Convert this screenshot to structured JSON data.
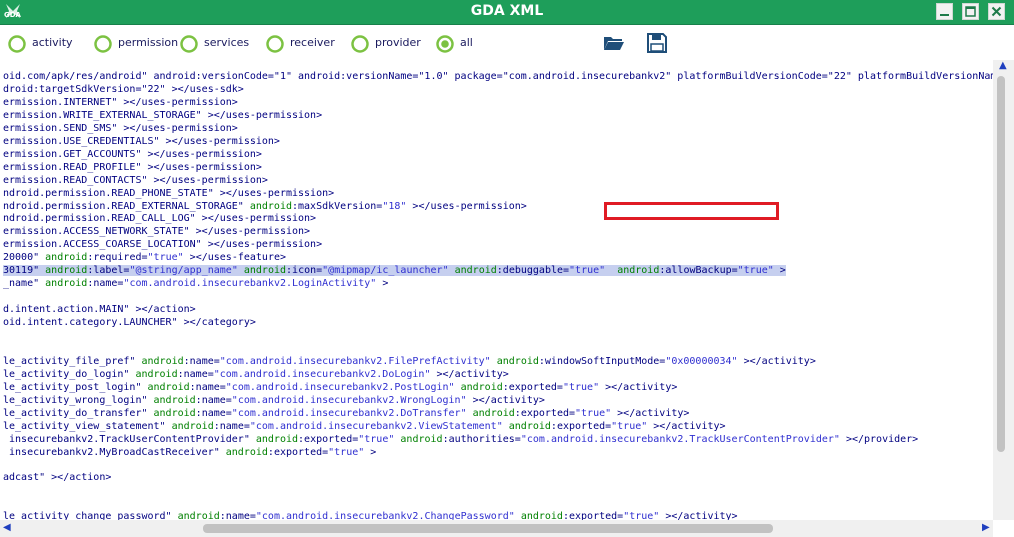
{
  "window": {
    "title": "GDA XML",
    "logo_text": "GDA"
  },
  "filters": [
    {
      "label": "activity"
    },
    {
      "label": "permission"
    },
    {
      "label": "services"
    },
    {
      "label": "receiver"
    },
    {
      "label": "provider"
    },
    {
      "label": "all",
      "selected": true
    }
  ],
  "toolbar": {
    "open_icon": "folder-open-icon",
    "save_icon": "floppy-save-icon"
  },
  "colors": {
    "titlebar": "#1e9e5a",
    "element": "#000080",
    "attr_ns": "#008000",
    "value": "#2f2fd0",
    "selection": "#c6cfef",
    "callout": "#e01b24"
  },
  "xml_lines": [
    [
      [
        "e",
        "oid.com/apk/res/android\" android:versionCode=\"1\" android:versionName=\"1.0\" package=\"com.android.insecurebankv2\" platformBuildVersionCode=\"22\" platformBuildVersionName"
      ]
    ],
    [
      [
        "e",
        "droid:targetSdkVersion=\"22\" ></uses-sdk>"
      ]
    ],
    [
      [
        "e",
        "ermission.INTERNET\" ></uses-permission>"
      ]
    ],
    [
      [
        "e",
        "ermission.WRITE_EXTERNAL_STORAGE\" ></uses-permission>"
      ]
    ],
    [
      [
        "e",
        "ermission.SEND_SMS\" ></uses-permission>"
      ]
    ],
    [
      [
        "e",
        "ermission.USE_CREDENTIALS\" ></uses-permission>"
      ]
    ],
    [
      [
        "e",
        "ermission.GET_ACCOUNTS\" ></uses-permission>"
      ]
    ],
    [
      [
        "e",
        "ermission.READ_PROFILE\" ></uses-permission>"
      ]
    ],
    [
      [
        "e",
        "ermission.READ_CONTACTS\" ></uses-permission>"
      ]
    ],
    [
      [
        "e",
        "ndroid.permission.READ_PHONE_STATE\" ></uses-permission>"
      ]
    ],
    [
      [
        "e",
        "ndroid.permission.READ_EXTERNAL_STORAGE\" "
      ],
      [
        "k",
        "android"
      ],
      [
        "ka",
        ":maxSdkVersion="
      ],
      [
        "v",
        "\"18\""
      ],
      [
        "e",
        " ></uses-permission>"
      ]
    ],
    [
      [
        "e",
        "ndroid.permission.READ_CALL_LOG\" ></uses-permission>"
      ]
    ],
    [
      [
        "e",
        "ermission.ACCESS_NETWORK_STATE\" ></uses-permission>"
      ]
    ],
    [
      [
        "e",
        "ermission.ACCESS_COARSE_LOCATION\" ></uses-permission>"
      ]
    ],
    [
      [
        "e",
        "20000\" "
      ],
      [
        "k",
        "android"
      ],
      [
        "ka",
        ":required="
      ],
      [
        "v",
        "\"true\""
      ],
      [
        "e",
        " ></uses-feature>"
      ]
    ],
    [
      [
        "e",
        "30119\" ",
        1
      ],
      [
        "k",
        "android",
        1
      ],
      [
        "ka",
        ":label=",
        1
      ],
      [
        "v",
        "\"@string/app_name\"",
        1
      ],
      [
        "e",
        " ",
        1
      ],
      [
        "k",
        "android",
        1
      ],
      [
        "ka",
        ":icon=",
        1
      ],
      [
        "v",
        "\"@mipmap/ic_launcher\"",
        1
      ],
      [
        "e",
        " ",
        1
      ],
      [
        "k",
        "android",
        1
      ],
      [
        "ka",
        ":debuggable=",
        1
      ],
      [
        "v",
        "\"true\"",
        1
      ],
      [
        "e",
        "  ",
        1
      ],
      [
        "k",
        "android",
        1
      ],
      [
        "ka",
        ":allowBackup=",
        1
      ],
      [
        "v",
        "\"true\"",
        1
      ],
      [
        "e",
        " >",
        1
      ]
    ],
    [
      [
        "e",
        "_name\" "
      ],
      [
        "k",
        "android"
      ],
      [
        "ka",
        ":name="
      ],
      [
        "v",
        "\"com.android.insecurebankv2.LoginActivity\""
      ],
      [
        "e",
        " >"
      ]
    ],
    [
      [
        "e",
        ""
      ]
    ],
    [
      [
        "e",
        "d.intent.action.MAIN\" ></action>"
      ]
    ],
    [
      [
        "e",
        "oid.intent.category.LAUNCHER\" ></category>"
      ]
    ],
    [
      [
        "e",
        ""
      ]
    ],
    [
      [
        "e",
        ""
      ]
    ],
    [
      [
        "e",
        "le_activity_file_pref\" "
      ],
      [
        "k",
        "android"
      ],
      [
        "ka",
        ":name="
      ],
      [
        "v",
        "\"com.android.insecurebankv2.FilePrefActivity\""
      ],
      [
        "e",
        " "
      ],
      [
        "k",
        "android"
      ],
      [
        "ka",
        ":windowSoftInputMode="
      ],
      [
        "v",
        "\"0x00000034\""
      ],
      [
        "e",
        " ></activity>"
      ]
    ],
    [
      [
        "e",
        "le_activity_do_login\" "
      ],
      [
        "k",
        "android"
      ],
      [
        "ka",
        ":name="
      ],
      [
        "v",
        "\"com.android.insecurebankv2.DoLogin\""
      ],
      [
        "e",
        " ></activity>"
      ]
    ],
    [
      [
        "e",
        "le_activity_post_login\" "
      ],
      [
        "k",
        "android"
      ],
      [
        "ka",
        ":name="
      ],
      [
        "v",
        "\"com.android.insecurebankv2.PostLogin\""
      ],
      [
        "e",
        " "
      ],
      [
        "k",
        "android"
      ],
      [
        "ka",
        ":exported="
      ],
      [
        "v",
        "\"true\""
      ],
      [
        "e",
        " ></activity>"
      ]
    ],
    [
      [
        "e",
        "le_activity_wrong_login\" "
      ],
      [
        "k",
        "android"
      ],
      [
        "ka",
        ":name="
      ],
      [
        "v",
        "\"com.android.insecurebankv2.WrongLogin\""
      ],
      [
        "e",
        " ></activity>"
      ]
    ],
    [
      [
        "e",
        "le_activity_do_transfer\" "
      ],
      [
        "k",
        "android"
      ],
      [
        "ka",
        ":name="
      ],
      [
        "v",
        "\"com.android.insecurebankv2.DoTransfer\""
      ],
      [
        "e",
        " "
      ],
      [
        "k",
        "android"
      ],
      [
        "ka",
        ":exported="
      ],
      [
        "v",
        "\"true\""
      ],
      [
        "e",
        " ></activity>"
      ]
    ],
    [
      [
        "e",
        "le_activity_view_statement\" "
      ],
      [
        "k",
        "android"
      ],
      [
        "ka",
        ":name="
      ],
      [
        "v",
        "\"com.android.insecurebankv2.ViewStatement\""
      ],
      [
        "e",
        " "
      ],
      [
        "k",
        "android"
      ],
      [
        "ka",
        ":exported="
      ],
      [
        "v",
        "\"true\""
      ],
      [
        "e",
        " ></activity>"
      ]
    ],
    [
      [
        "e",
        " insecurebankv2.TrackUserContentProvider\" "
      ],
      [
        "k",
        "android"
      ],
      [
        "ka",
        ":exported="
      ],
      [
        "v",
        "\"true\""
      ],
      [
        "e",
        " "
      ],
      [
        "k",
        "android"
      ],
      [
        "ka",
        ":authorities="
      ],
      [
        "v",
        "\"com.android.insecurebankv2.TrackUserContentProvider\""
      ],
      [
        "e",
        " ></provider>"
      ]
    ],
    [
      [
        "e",
        " insecurebankv2.MyBroadCastReceiver\" "
      ],
      [
        "k",
        "android"
      ],
      [
        "ka",
        ":exported="
      ],
      [
        "v",
        "\"true\""
      ],
      [
        "e",
        " >"
      ]
    ],
    [
      [
        "e",
        ""
      ]
    ],
    [
      [
        "e",
        "adcast\" ></action>"
      ]
    ],
    [
      [
        "e",
        ""
      ]
    ],
    [
      [
        "e",
        ""
      ]
    ],
    [
      [
        "e",
        "le_activity_change_password\" "
      ],
      [
        "k",
        "android"
      ],
      [
        "ka",
        ":name="
      ],
      [
        "v",
        "\"com.android.insecurebankv2.ChangePassword\""
      ],
      [
        "e",
        " "
      ],
      [
        "k",
        "android"
      ],
      [
        "ka",
        ":exported="
      ],
      [
        "v",
        "\"true\""
      ],
      [
        "e",
        " ></activity>"
      ]
    ]
  ]
}
